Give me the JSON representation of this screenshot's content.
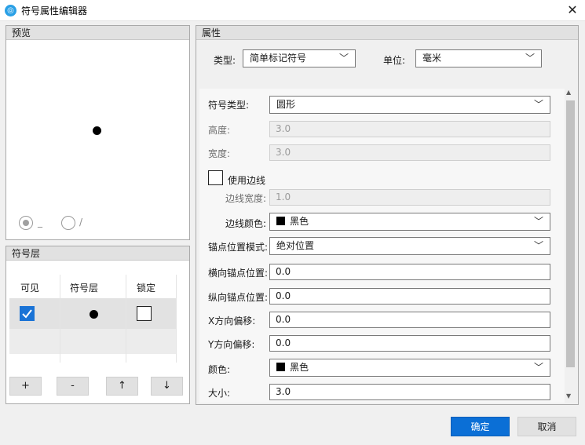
{
  "window": {
    "title": "符号属性编辑器",
    "close_glyph": "✕"
  },
  "preview": {
    "header": "预览",
    "radio_options": [
      {
        "label": "_",
        "selected": true
      },
      {
        "label": "/",
        "selected": false
      }
    ]
  },
  "layers": {
    "header": "符号层",
    "columns": [
      "可见",
      "符号层",
      "锁定"
    ],
    "rows": [
      {
        "visible": true,
        "locked": false
      }
    ],
    "buttons": {
      "add": "+",
      "remove": "-",
      "up": "↑",
      "down": "↓"
    }
  },
  "properties": {
    "header": "属性",
    "type_label": "类型:",
    "type_value": "简单标记符号",
    "unit_label": "单位:",
    "unit_value": "毫米",
    "symbol_type_label": "符号类型:",
    "symbol_type_value": "圆形",
    "height_label": "高度:",
    "height_value": "3.0",
    "width_label": "宽度:",
    "width_value": "3.0",
    "use_border_label": "使用边线",
    "use_border_checked": false,
    "border_width_label": "边线宽度:",
    "border_width_value": "1.0",
    "border_color_label": "边线颜色:",
    "border_color_value": "黑色",
    "anchor_mode_label": "锚点位置模式:",
    "anchor_mode_value": "绝对位置",
    "h_anchor_label": "横向锚点位置:",
    "h_anchor_value": "0.0",
    "v_anchor_label": "纵向锚点位置:",
    "v_anchor_value": "0.0",
    "x_offset_label": "X方向偏移:",
    "x_offset_value": "0.0",
    "y_offset_label": "Y方向偏移:",
    "y_offset_value": "0.0",
    "color_label": "颜色:",
    "color_value": "黑色",
    "size_label": "大小:",
    "size_value": "3.0",
    "chevron": "﹀"
  },
  "footer": {
    "ok": "确定",
    "cancel": "取消"
  },
  "colors": {
    "accent": "#0b6fd6",
    "swatch": "#000000"
  }
}
